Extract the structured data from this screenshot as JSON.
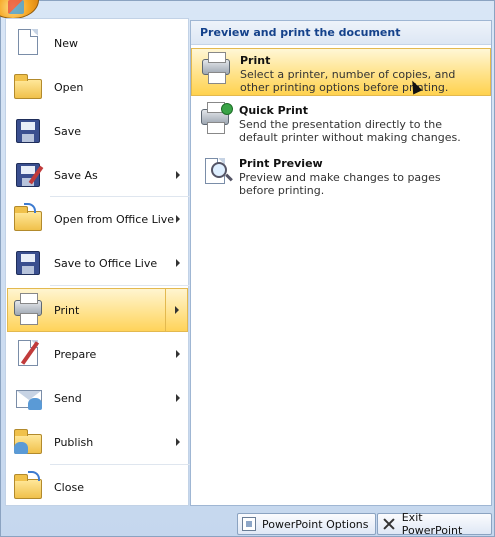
{
  "menu": {
    "items": [
      {
        "label": "New",
        "icon": "new-document-icon"
      },
      {
        "label": "Open",
        "icon": "open-folder-icon"
      },
      {
        "label": "Save",
        "icon": "save-disk-icon"
      },
      {
        "label": "Save As",
        "icon": "save-as-icon"
      },
      {
        "label": "Open from Office Live",
        "icon": "open-office-live-icon"
      },
      {
        "label": "Save to Office Live",
        "icon": "save-office-live-icon"
      },
      {
        "label": "Print",
        "icon": "printer-icon"
      },
      {
        "label": "Prepare",
        "icon": "prepare-icon"
      },
      {
        "label": "Send",
        "icon": "send-icon"
      },
      {
        "label": "Publish",
        "icon": "publish-icon"
      },
      {
        "label": "Close",
        "icon": "close-folder-icon"
      }
    ]
  },
  "panel": {
    "header": "Preview and print the document",
    "items": [
      {
        "title": "Print",
        "description": "Select a printer, number of copies, and other printing options before printing.",
        "icon": "printer-icon"
      },
      {
        "title": "Quick Print",
        "description": "Send the presentation directly to the default printer without making changes.",
        "icon": "quick-print-icon"
      },
      {
        "title": "Print Preview",
        "description": "Preview and make changes to pages before printing.",
        "icon": "print-preview-icon"
      }
    ]
  },
  "footer": {
    "options_label": "PowerPoint Options",
    "exit_label": "Exit PowerPoint"
  }
}
